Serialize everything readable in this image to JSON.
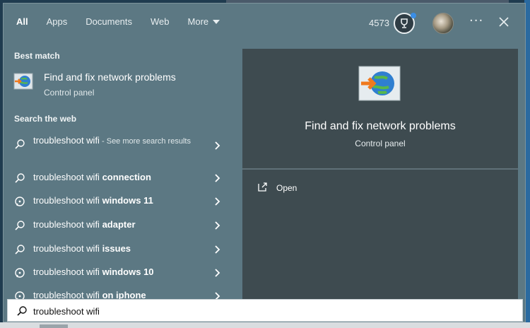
{
  "header": {
    "tabs": [
      {
        "label": "All",
        "active": true
      },
      {
        "label": "Apps",
        "active": false
      },
      {
        "label": "Documents",
        "active": false
      },
      {
        "label": "Web",
        "active": false
      },
      {
        "label": "More",
        "active": false
      }
    ],
    "points": "4573",
    "icons": {
      "rewards": "trophy-icon",
      "more": "ellipsis-icon",
      "close": "close-icon",
      "profile": "avatar"
    }
  },
  "best_match": {
    "heading": "Best match",
    "title": "Find and fix network problems",
    "subtitle": "Control panel",
    "icon": "network-globe-icon"
  },
  "web": {
    "heading": "Search the web",
    "items": [
      {
        "prefix": "troubleshoot wifi",
        "bold": "",
        "extra": " - See more search results",
        "icon": "search-icon"
      },
      {
        "prefix": "troubleshoot wifi ",
        "bold": "connection",
        "extra": "",
        "icon": "search-icon"
      },
      {
        "prefix": "troubleshoot wifi ",
        "bold": "windows 11",
        "extra": "",
        "icon": "chat-search-icon"
      },
      {
        "prefix": "troubleshoot wifi ",
        "bold": "adapter",
        "extra": "",
        "icon": "search-icon"
      },
      {
        "prefix": "troubleshoot wifi ",
        "bold": "issues",
        "extra": "",
        "icon": "search-icon"
      },
      {
        "prefix": "troubleshoot wifi ",
        "bold": "windows 10",
        "extra": "",
        "icon": "chat-search-icon"
      },
      {
        "prefix": "troubleshoot wifi ",
        "bold": "on iphone",
        "extra": "",
        "icon": "chat-search-icon"
      }
    ]
  },
  "preview": {
    "title": "Find and fix network problems",
    "subtitle": "Control panel",
    "actions": [
      {
        "label": "Open",
        "icon": "open-external-icon"
      }
    ]
  },
  "search": {
    "value": "troubleshoot wifi",
    "placeholder": ""
  },
  "colors": {
    "panel": "#5c7883",
    "preview": "#3e4b50",
    "accent_dot": "#3a8ee6"
  }
}
